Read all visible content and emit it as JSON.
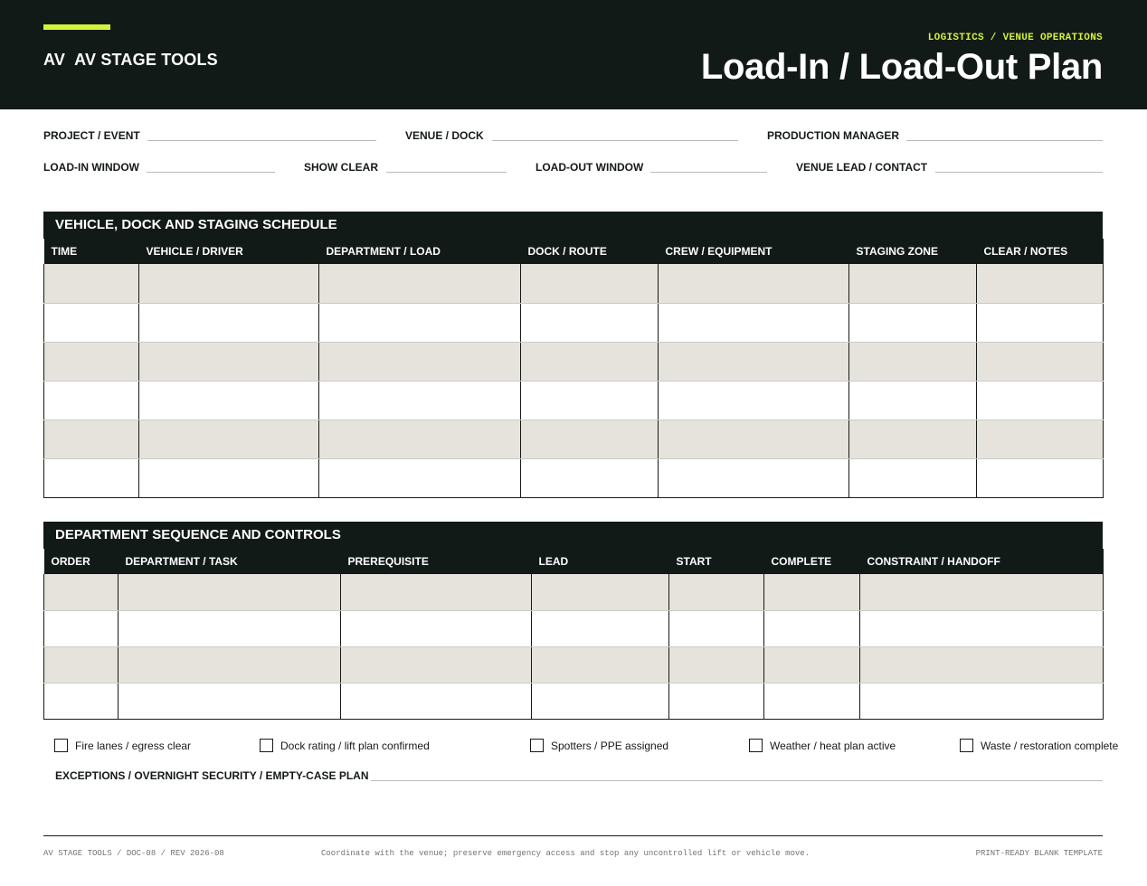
{
  "header": {
    "brand_mark": "AV",
    "brand_name": "AV STAGE TOOLS",
    "kicker": "LOGISTICS / VENUE OPERATIONS",
    "title": "Load-In / Load-Out Plan"
  },
  "fields": {
    "project_event": "PROJECT / EVENT",
    "venue_dock": "VENUE / DOCK",
    "production_manager": "PRODUCTION MANAGER",
    "load_in_window": "LOAD-IN WINDOW",
    "show_clear": "SHOW CLEAR",
    "load_out_window": "LOAD-OUT WINDOW",
    "venue_lead_contact": "VENUE LEAD / CONTACT"
  },
  "schedule": {
    "title": "VEHICLE, DOCK AND STAGING SCHEDULE",
    "columns": [
      "TIME",
      "VEHICLE / DRIVER",
      "DEPARTMENT / LOAD",
      "DOCK / ROUTE",
      "CREW / EQUIPMENT",
      "STAGING ZONE",
      "CLEAR / NOTES"
    ],
    "row_count": 6
  },
  "sequence": {
    "title": "DEPARTMENT SEQUENCE AND CONTROLS",
    "columns": [
      "ORDER",
      "DEPARTMENT / TASK",
      "PREREQUISITE",
      "LEAD",
      "START",
      "COMPLETE",
      "CONSTRAINT / HANDOFF"
    ],
    "row_count": 4
  },
  "checklist": [
    "Fire lanes / egress clear",
    "Dock rating / lift plan confirmed",
    "Spotters / PPE assigned",
    "Weather / heat plan active",
    "Waste / restoration complete"
  ],
  "exceptions_label": "EXCEPTIONS / OVERNIGHT SECURITY / EMPTY-CASE PLAN",
  "footer": {
    "doc_id": "AV STAGE TOOLS / DOC-08 / REV 2026-08",
    "note": "Coordinate with the venue; preserve emergency access and stop any uncontrolled lift or vehicle move.",
    "template_label": "PRINT-READY BLANK TEMPLATE"
  },
  "colors": {
    "header_bg": "#121a18",
    "accent": "#d4f23a",
    "row_shade": "#e6e3dd"
  }
}
